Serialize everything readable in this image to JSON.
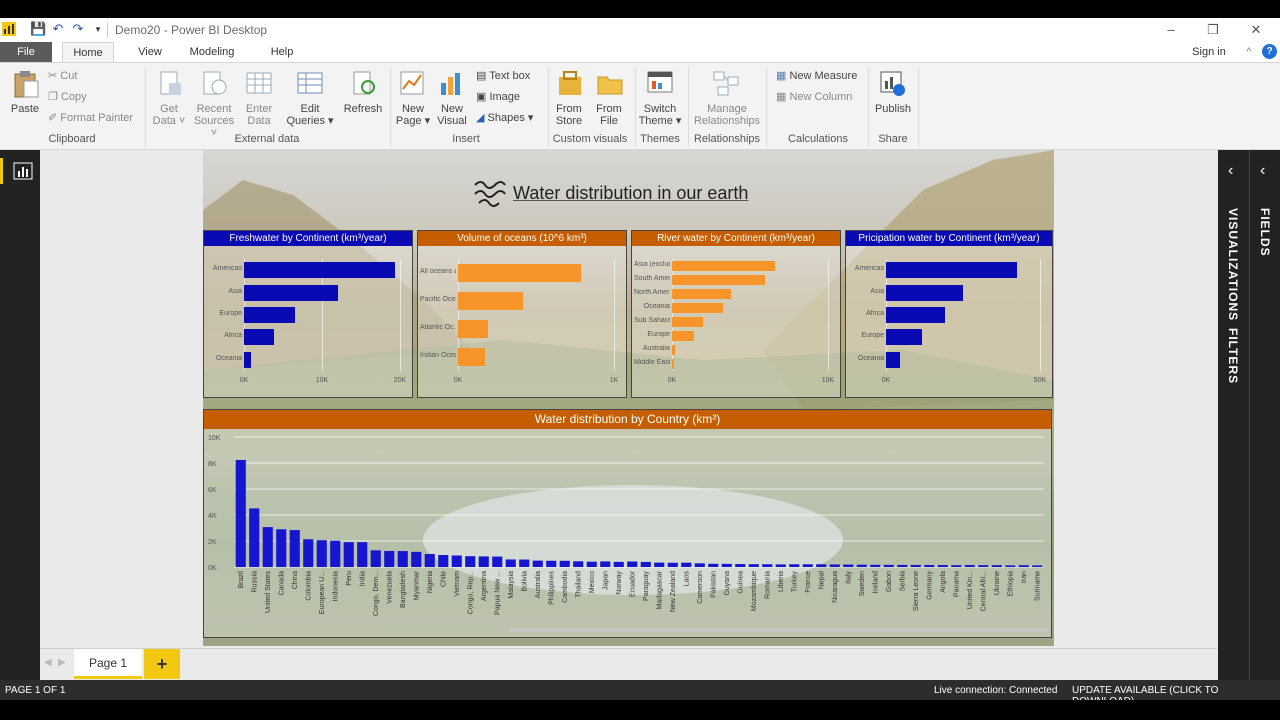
{
  "window": {
    "title": "Demo20 - Power BI Desktop",
    "sign_in": "Sign in",
    "minimize": "–",
    "restore": "❐",
    "close": "✕",
    "help": "?",
    "collapse": "^"
  },
  "tabs": {
    "file": "File",
    "home": "Home",
    "view": "View",
    "modeling": "Modeling",
    "help": "Help"
  },
  "ribbon": {
    "paste": "Paste",
    "cut": "Cut",
    "copy": "Copy",
    "format_painter": "Format Painter",
    "clipboard": "Clipboard",
    "get_data": [
      "Get",
      "Data ˅"
    ],
    "recent_sources": [
      "Recent",
      "Sources ˅"
    ],
    "enter_data": [
      "Enter",
      "Data"
    ],
    "edit_queries": [
      "Edit",
      "Queries ▾"
    ],
    "refresh": "Refresh",
    "external_data": "External data",
    "new_page": [
      "New",
      "Page ▾"
    ],
    "new_visual": [
      "New",
      "Visual"
    ],
    "text_box": "Text box",
    "image": "Image",
    "shapes": "Shapes ▾",
    "insert": "Insert",
    "from_store": [
      "From",
      "Store"
    ],
    "from_file": [
      "From",
      "File"
    ],
    "custom_visuals": "Custom visuals",
    "switch_theme": [
      "Switch",
      "Theme ▾"
    ],
    "themes": "Themes",
    "manage_relationships": [
      "Manage",
      "Relationships"
    ],
    "relationships": "Relationships",
    "new_measure": "New Measure",
    "new_column": "New Column",
    "calculations": "Calculations",
    "publish": "Publish",
    "share": "Share"
  },
  "report": {
    "title": "Water distribution in our earth",
    "panels": [
      {
        "title": "Freshwater by Continent (km³/year)",
        "categories": [
          "Americas",
          "Asia",
          "Europe",
          "Africa",
          "Oceania"
        ],
        "values": [
          19300,
          12000,
          6500,
          3900,
          900
        ],
        "ticks": [
          "0K",
          "10K",
          "20K"
        ],
        "max": 20000,
        "color": "#0a0ab4",
        "hdr": "#0a0ab4"
      },
      {
        "title": "Volume of oceans (10^6 km³)",
        "categories": [
          "All oceans a...",
          "Pacific Ocean",
          "Atlantic Oc...",
          "Indian Ocean"
        ],
        "values": [
          1335,
          710,
          323,
          292
        ],
        "ticks": [
          "0K",
          "1K"
        ],
        "max": 1700,
        "color": "#f7942a",
        "hdr": "#c45e00"
      },
      {
        "title": "River water by Continent (km³/year)",
        "categories": [
          "Asia (exclud...",
          "South Amer...",
          "North Amer...",
          "Oceania",
          "Sub Sahara...",
          "Europe",
          "Australia",
          "Middle East"
        ],
        "values": [
          13200,
          11900,
          7600,
          6500,
          4000,
          2800,
          400,
          100
        ],
        "ticks": [
          "0K",
          "10K"
        ],
        "max": 20000,
        "color": "#f7942a",
        "hdr": "#c45e00"
      },
      {
        "title": "Pricipation water by Continent (km³/year)",
        "categories": [
          "Americas",
          "Asia",
          "Africa",
          "Europe",
          "Oceania"
        ],
        "values": [
          51000,
          30000,
          23000,
          14000,
          5500
        ],
        "ticks": [
          "0K",
          "50K"
        ],
        "max": 60000,
        "color": "#0a0ab4",
        "hdr": "#0a0ab4"
      }
    ],
    "country": {
      "title": "Water distribution by Country (km³)",
      "ticks": [
        "0K",
        "2K",
        "4K",
        "6K",
        "8K",
        "10K"
      ],
      "max": 10000,
      "categories": [
        "Brazil",
        "Russia",
        "United States",
        "Canada",
        "China",
        "Colombia",
        "European U...",
        "Indonesia",
        "Peru",
        "India",
        "Congo, Dem...",
        "Venezuela",
        "Bangladesh",
        "Myanmar",
        "Nigeria",
        "Chile",
        "Vietnam",
        "Congo, Rep...",
        "Argentina",
        "Papua New ...",
        "Malaysia",
        "Bolivia",
        "Australia",
        "Philippines",
        "Cambodia",
        "Thailand",
        "Mexico",
        "Japan",
        "Norway",
        "Ecuador",
        "Paraguay",
        "Madagascar",
        "New Zealand",
        "Laos",
        "Cameroon",
        "Pakistan",
        "Guyana",
        "Guinea",
        "Mozambique",
        "Romania",
        "Liberia",
        "Turkey",
        "France",
        "Nepal",
        "Nicaragua",
        "Italy",
        "Sweden",
        "Iceland",
        "Gabon",
        "Serbia",
        "Sierra Leone",
        "Germany",
        "Angola",
        "Panama",
        "United Kin...",
        "Central Afri...",
        "Ukraine",
        "Ethiopia",
        "Iran",
        "Suriname"
      ],
      "values": [
        8233,
        4508,
        3069,
        2902,
        2840,
        2132,
        2057,
        2019,
        1913,
        1911,
        1283,
        1233,
        1227,
        1168,
        1000,
        922,
        884,
        832,
        814,
        801,
        580,
        574,
        492,
        479,
        476,
        439,
        409,
        430,
        393,
        424,
        388,
        337,
        327,
        333,
        283,
        247,
        241,
        226,
        217,
        212,
        200,
        212,
        211,
        210,
        197,
        191,
        179,
        170,
        164,
        162,
        160,
        154,
        148,
        139,
        147,
        141,
        140,
        122,
        137,
        122
      ]
    }
  },
  "page_tab": "Page 1",
  "add_page": "+",
  "right_panes": {
    "visualizations": "VISUALIZATIONS",
    "filters": "FILTERS",
    "fields": "FIELDS",
    "arrow": "‹"
  },
  "status": {
    "page": "PAGE 1 OF 1",
    "live": "Live connection: Connected",
    "update": "UPDATE AVAILABLE (CLICK TO DOWNLOAD)"
  }
}
